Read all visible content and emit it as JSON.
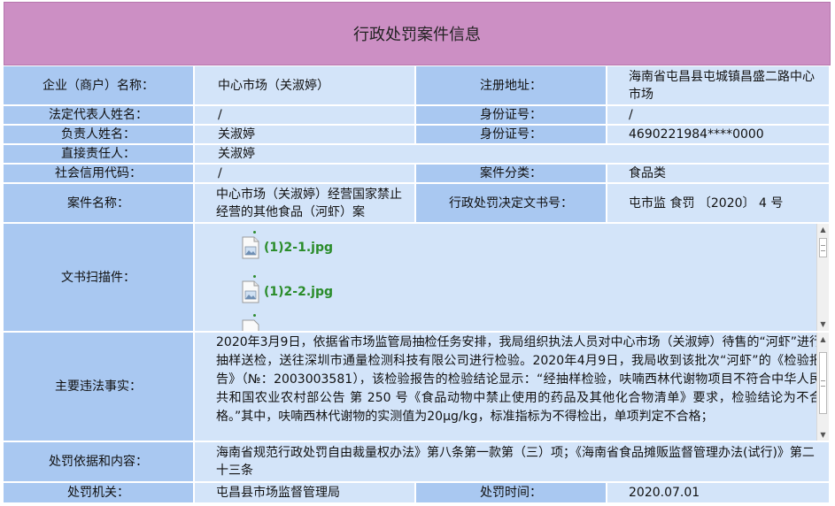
{
  "title": "行政处罚案件信息",
  "rows": {
    "company_label": "企业（商户）名称：",
    "company_value": "中心市场（关淑婷）",
    "address_label": "注册地址：",
    "address_value": "海南省屯昌县屯城镇昌盛二路中心市场",
    "legal_rep_label": "法定代表人姓名：",
    "legal_rep_value": "/",
    "id1_label": "身份证号：",
    "id1_value": "/",
    "responsible_label": "负责人姓名：",
    "responsible_value": "关淑婷",
    "id2_label": "身份证号：",
    "id2_value": "4690221984****0000",
    "direct_label": "直接责任人：",
    "direct_value": "关淑婷",
    "credit_label": "社会信用代码：",
    "credit_value": "/",
    "category_label": "案件分类：",
    "category_value": "食品类",
    "case_name_label": "案件名称：",
    "case_name_value": "中心市场（关淑婷）经营国家禁止经营的其他食品（河虾）案",
    "decision_label": "行政处罚决定文书号：",
    "decision_value": "屯市监 食罚 〔2020〕 4 号",
    "scan_label": "文书扫描件：",
    "facts_label": "主要违法事实：",
    "facts_value": "2020年3月9日，依据省市场监管局抽检任务安排，我局组织执法人员对中心市场（关淑婷）待售的“河虾”进行抽样送检，送往深圳市通量检测科技有限公司进行检验。2020年4月9日，我局收到该批次“河虾”的《检验报告》（№：2003003581），该检验报告的检验结论显示：“经抽样检验，呋喃西林代谢物项目不符合中华人民共和国农业农村部公告 第 250 号《食品动物中禁止使用的药品及其他化合物清单》要求，检验结论为不合格。”其中，呋喃西林代谢物的实测值为20μg/kg，标准指标为不得检出，单项判定不合格；",
    "basis_label": "处罚依据和内容：",
    "basis_value": "海南省规范行政处罚自由裁量权办法》第八条第一款第（三）项；《海南省食品摊贩监督管理办法(试行)》第二十三条",
    "authority_label": "处罚机关：",
    "authority_value": "屯昌县市场监督管理局",
    "time_label": "处罚时间：",
    "time_value": "2020.07.01"
  },
  "attachments": [
    {
      "name": "(1)2-1.jpg",
      "icon": "image-file-icon"
    },
    {
      "name": "(1)2-2.jpg",
      "icon": "image-file-icon"
    }
  ],
  "colors": {
    "header": "#cc8fc4",
    "label_bg": "#a9c8f1",
    "value_bg": "#d3e4f9",
    "link": "#2a8c2a"
  }
}
